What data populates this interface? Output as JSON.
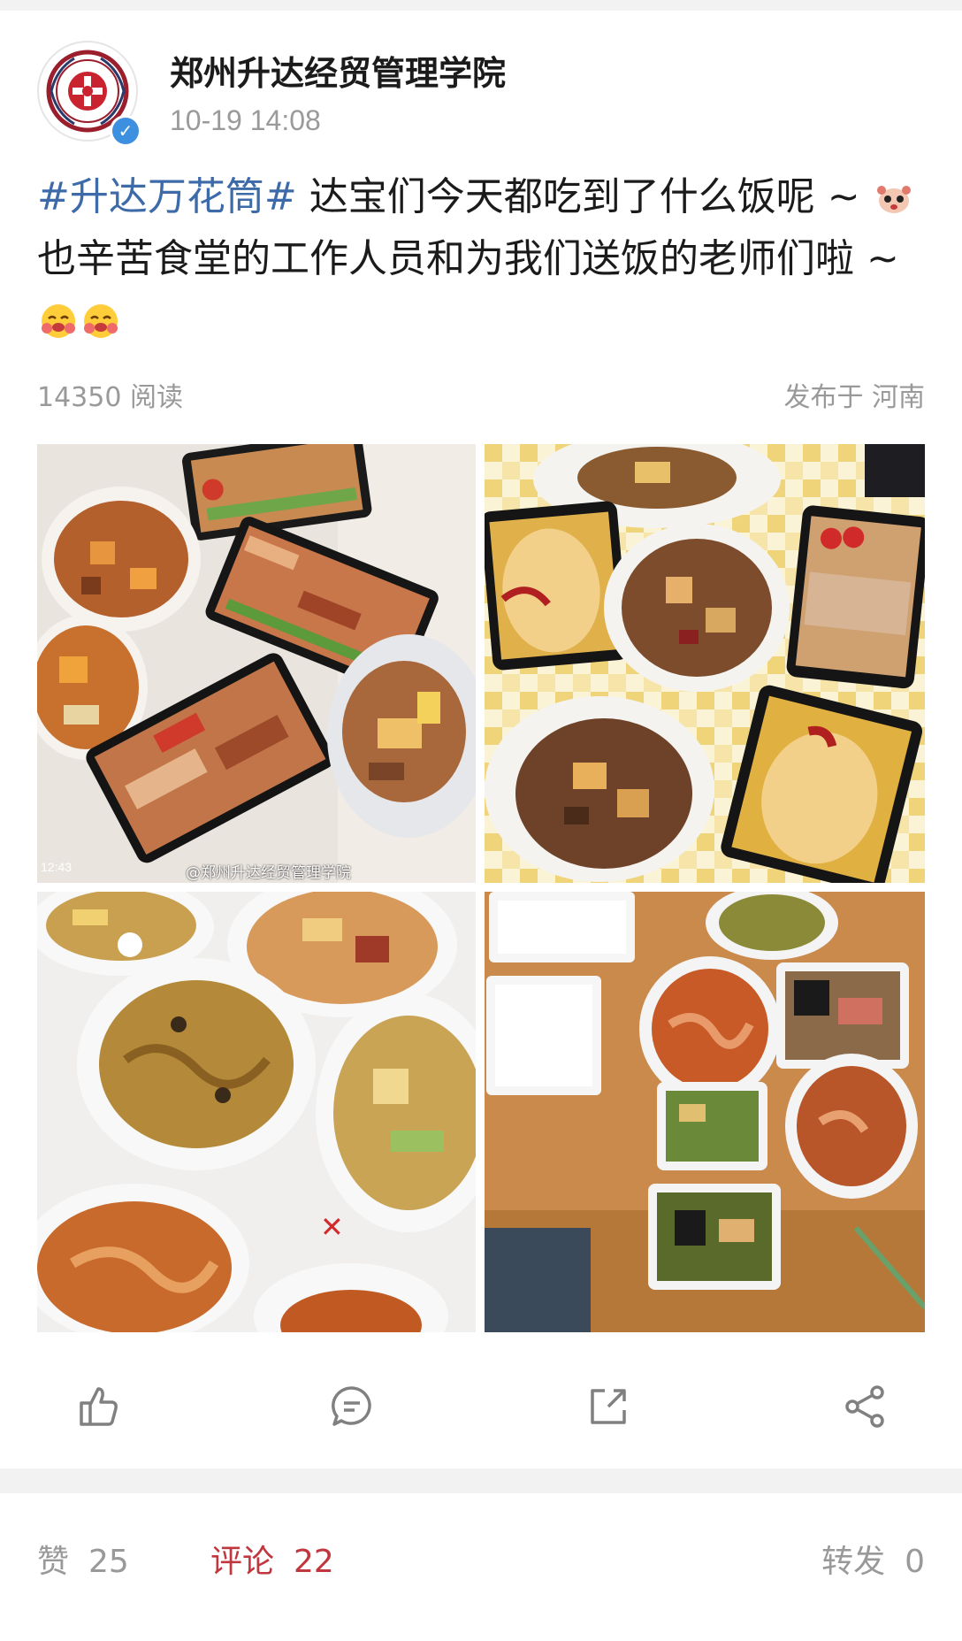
{
  "account": {
    "name": "郑州升达经贸管理学院",
    "time": "10-19 14:08"
  },
  "post": {
    "hashtag": "#升达万花筒#",
    "text_1": " 达宝们今天都吃到了什么饭呢 ~ ",
    "text_2": "也辛苦食堂的工作人员和为我们送饭的老师们啦 ~ "
  },
  "meta": {
    "reads": "14350 阅读",
    "location": "发布于 河南"
  },
  "photo1": {
    "watermark": "@郑州升达经贸管理学院",
    "clock": "12:43"
  },
  "actions": [
    "like-icon",
    "comment-icon",
    "share-icon",
    "forward-icon"
  ],
  "tabs": {
    "likes_label": "赞",
    "likes_count": "25",
    "comments_label": "评论",
    "comments_count": "22",
    "reposts_label": "转发",
    "reposts_count": "0"
  },
  "colors": {
    "hashtag": "#3d6aa8",
    "active_tab": "#c0373f",
    "verified": "#3d8fe0"
  }
}
